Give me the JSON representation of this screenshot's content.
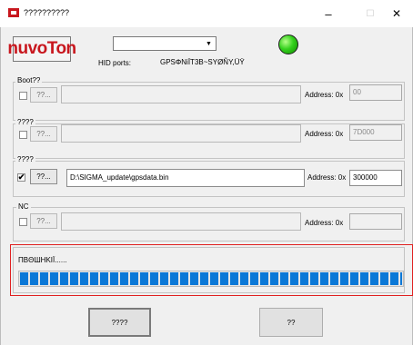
{
  "window": {
    "title": "??????????"
  },
  "titlebar": {
    "minimize": "–",
    "maximize": "☐",
    "close": "✕"
  },
  "logo": {
    "text": "nuvoTon",
    "color": "#c8171e"
  },
  "hid": {
    "label": "HID ports:",
    "value": "GPSΦNiÏT3B~SYØÑY,ÜŸ",
    "selected": ""
  },
  "status_led": {
    "color": "#34d11d"
  },
  "groups": [
    {
      "label": "Boot??",
      "checked": false,
      "browse": "??...",
      "path": "",
      "address_label": "Address: 0x",
      "address": "00",
      "enabled": false
    },
    {
      "label": "????",
      "checked": false,
      "browse": "??...",
      "path": "",
      "address_label": "Address: 0x",
      "address": "7D000",
      "enabled": false
    },
    {
      "label": "????",
      "checked": true,
      "browse": "??...",
      "path": "D:\\SIGMA_update\\gpsdata.bin",
      "address_label": "Address: 0x",
      "address": "300000",
      "enabled": true
    },
    {
      "label": "NC",
      "checked": false,
      "browse": "??...",
      "path": "",
      "address_label": "Address: 0x",
      "address": "",
      "enabled": false
    }
  ],
  "progress": {
    "label": "ΠΒΘШΗΚΙΪ......",
    "percent": 100,
    "color": "#0a78d7"
  },
  "buttons": {
    "start": "????",
    "exit": "??"
  },
  "check_mark": "✔"
}
